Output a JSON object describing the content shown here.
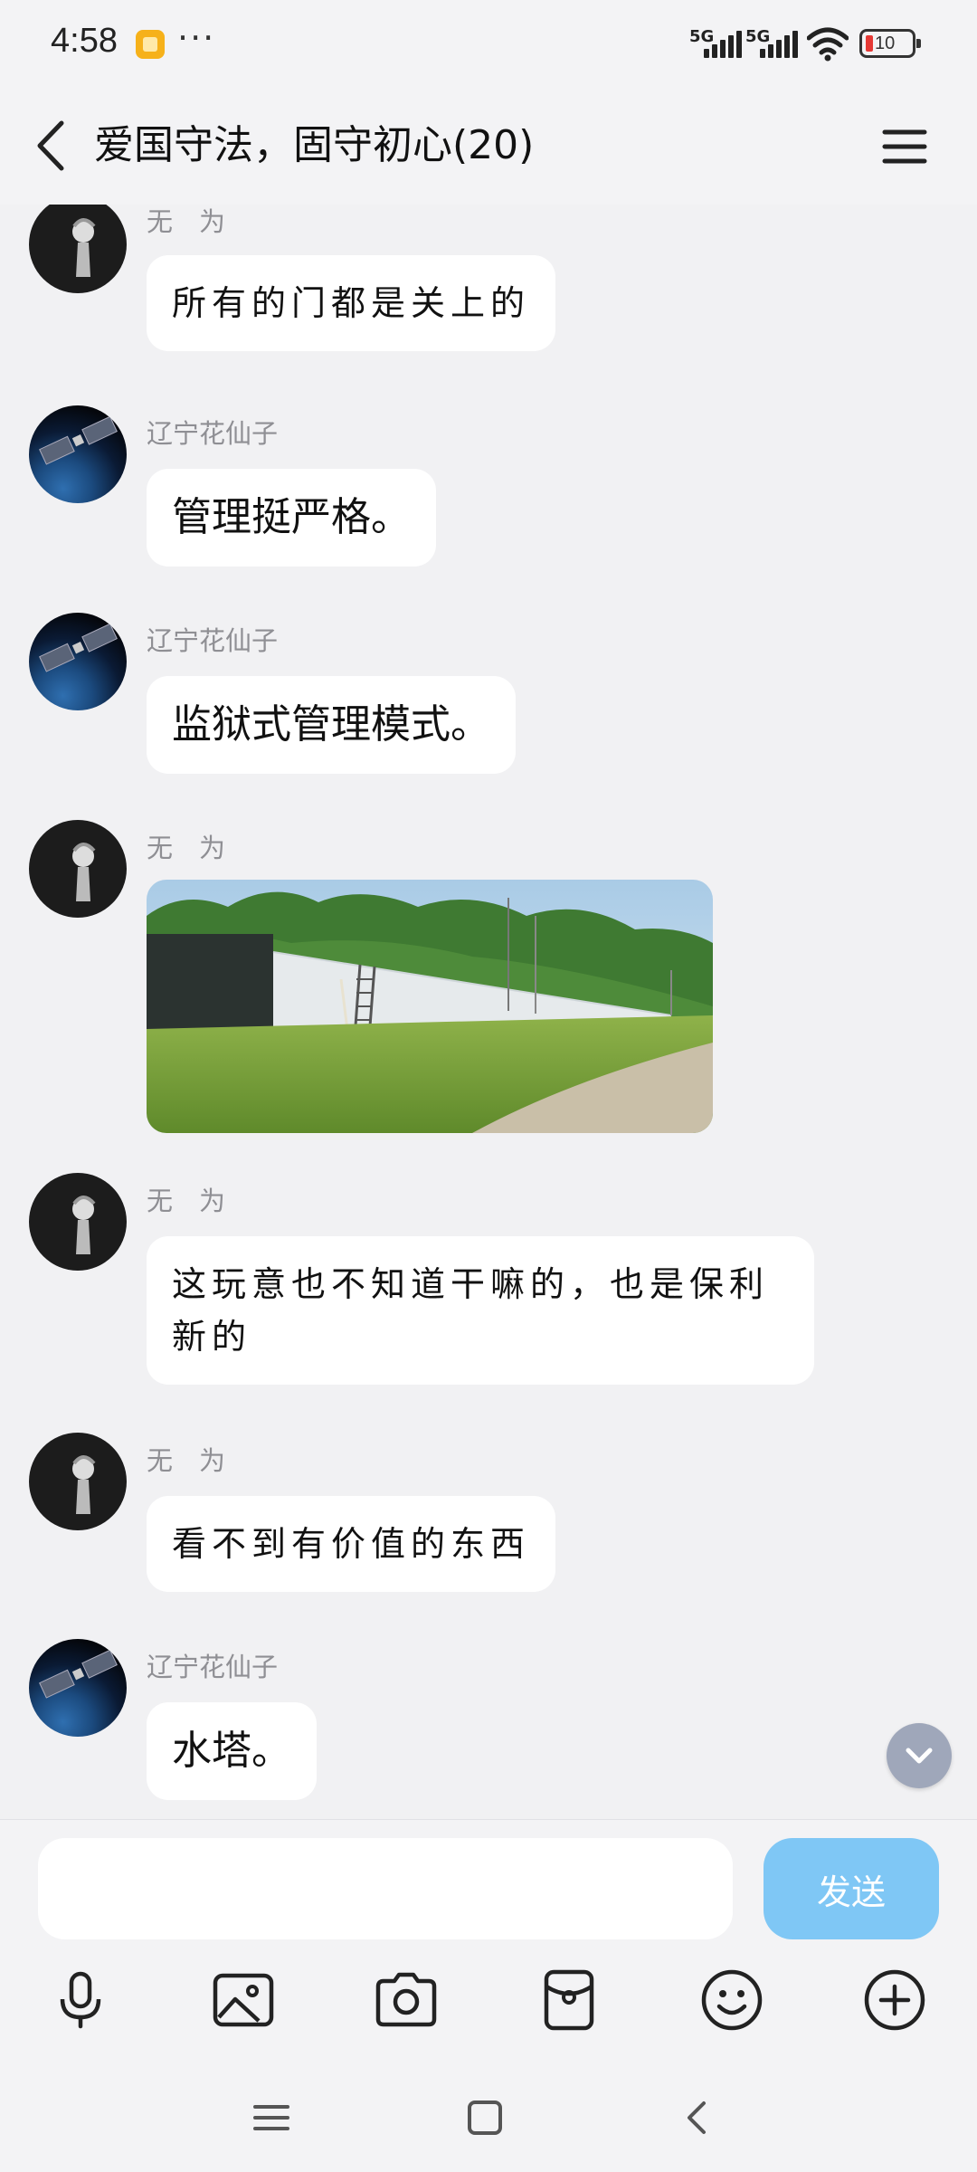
{
  "status_bar": {
    "time": "4:58",
    "dots": "···",
    "net1": "5G",
    "net2": "5G",
    "battery": "10",
    "app_icon": "notes-app-icon"
  },
  "header": {
    "title": "爱国守法，固守初心(20)",
    "back_icon": "chevron-left-icon",
    "menu_icon": "hamburger-menu-icon"
  },
  "messages": [
    {
      "sender": "无　为",
      "avatar": "dark-boy-avatar",
      "type": "text",
      "style": "handwriting",
      "text": "所有的门都是关上的"
    },
    {
      "sender": "辽宁花仙子",
      "avatar": "satellite-avatar",
      "type": "text",
      "style": "normal",
      "text": "管理挺严格。"
    },
    {
      "sender": "辽宁花仙子",
      "avatar": "satellite-avatar",
      "type": "text",
      "style": "normal",
      "text": "监狱式管理模式。"
    },
    {
      "sender": "无　为",
      "avatar": "dark-boy-avatar",
      "type": "image",
      "image": "water-tank-wall-photo"
    },
    {
      "sender": "无　为",
      "avatar": "dark-boy-avatar",
      "type": "text",
      "style": "handwriting",
      "text": "这玩意也不知道干嘛的，也是保利新的"
    },
    {
      "sender": "无　为",
      "avatar": "dark-boy-avatar",
      "type": "text",
      "style": "handwriting",
      "text": "看不到有价值的东西"
    },
    {
      "sender": "辽宁花仙子",
      "avatar": "satellite-avatar",
      "type": "text",
      "style": "normal",
      "text": "水塔。"
    }
  ],
  "input": {
    "placeholder": "",
    "send_label": "发送"
  },
  "toolbar": [
    "microphone-icon",
    "image-icon",
    "camera-icon",
    "red-packet-icon",
    "emoji-icon",
    "plus-icon"
  ],
  "nav": [
    "menu-icon",
    "home-icon",
    "back-icon"
  ],
  "colors": {
    "background": "#f1f1f3",
    "bubble": "#ffffff",
    "send_button": "#7fc7f5",
    "sender_name": "#8f8f94"
  }
}
